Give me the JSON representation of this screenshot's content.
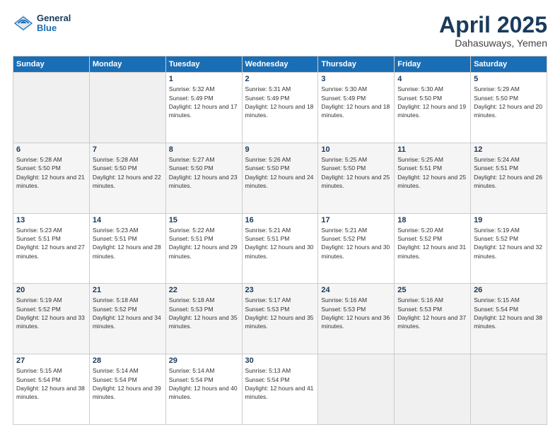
{
  "header": {
    "logo_general": "General",
    "logo_blue": "Blue",
    "month": "April 2025",
    "location": "Dahasuways, Yemen"
  },
  "days_of_week": [
    "Sunday",
    "Monday",
    "Tuesday",
    "Wednesday",
    "Thursday",
    "Friday",
    "Saturday"
  ],
  "weeks": [
    [
      {
        "day": "",
        "sunrise": "",
        "sunset": "",
        "daylight": ""
      },
      {
        "day": "",
        "sunrise": "",
        "sunset": "",
        "daylight": ""
      },
      {
        "day": "1",
        "sunrise": "Sunrise: 5:32 AM",
        "sunset": "Sunset: 5:49 PM",
        "daylight": "Daylight: 12 hours and 17 minutes."
      },
      {
        "day": "2",
        "sunrise": "Sunrise: 5:31 AM",
        "sunset": "Sunset: 5:49 PM",
        "daylight": "Daylight: 12 hours and 18 minutes."
      },
      {
        "day": "3",
        "sunrise": "Sunrise: 5:30 AM",
        "sunset": "Sunset: 5:49 PM",
        "daylight": "Daylight: 12 hours and 18 minutes."
      },
      {
        "day": "4",
        "sunrise": "Sunrise: 5:30 AM",
        "sunset": "Sunset: 5:50 PM",
        "daylight": "Daylight: 12 hours and 19 minutes."
      },
      {
        "day": "5",
        "sunrise": "Sunrise: 5:29 AM",
        "sunset": "Sunset: 5:50 PM",
        "daylight": "Daylight: 12 hours and 20 minutes."
      }
    ],
    [
      {
        "day": "6",
        "sunrise": "Sunrise: 5:28 AM",
        "sunset": "Sunset: 5:50 PM",
        "daylight": "Daylight: 12 hours and 21 minutes."
      },
      {
        "day": "7",
        "sunrise": "Sunrise: 5:28 AM",
        "sunset": "Sunset: 5:50 PM",
        "daylight": "Daylight: 12 hours and 22 minutes."
      },
      {
        "day": "8",
        "sunrise": "Sunrise: 5:27 AM",
        "sunset": "Sunset: 5:50 PM",
        "daylight": "Daylight: 12 hours and 23 minutes."
      },
      {
        "day": "9",
        "sunrise": "Sunrise: 5:26 AM",
        "sunset": "Sunset: 5:50 PM",
        "daylight": "Daylight: 12 hours and 24 minutes."
      },
      {
        "day": "10",
        "sunrise": "Sunrise: 5:25 AM",
        "sunset": "Sunset: 5:50 PM",
        "daylight": "Daylight: 12 hours and 25 minutes."
      },
      {
        "day": "11",
        "sunrise": "Sunrise: 5:25 AM",
        "sunset": "Sunset: 5:51 PM",
        "daylight": "Daylight: 12 hours and 25 minutes."
      },
      {
        "day": "12",
        "sunrise": "Sunrise: 5:24 AM",
        "sunset": "Sunset: 5:51 PM",
        "daylight": "Daylight: 12 hours and 26 minutes."
      }
    ],
    [
      {
        "day": "13",
        "sunrise": "Sunrise: 5:23 AM",
        "sunset": "Sunset: 5:51 PM",
        "daylight": "Daylight: 12 hours and 27 minutes."
      },
      {
        "day": "14",
        "sunrise": "Sunrise: 5:23 AM",
        "sunset": "Sunset: 5:51 PM",
        "daylight": "Daylight: 12 hours and 28 minutes."
      },
      {
        "day": "15",
        "sunrise": "Sunrise: 5:22 AM",
        "sunset": "Sunset: 5:51 PM",
        "daylight": "Daylight: 12 hours and 29 minutes."
      },
      {
        "day": "16",
        "sunrise": "Sunrise: 5:21 AM",
        "sunset": "Sunset: 5:51 PM",
        "daylight": "Daylight: 12 hours and 30 minutes."
      },
      {
        "day": "17",
        "sunrise": "Sunrise: 5:21 AM",
        "sunset": "Sunset: 5:52 PM",
        "daylight": "Daylight: 12 hours and 30 minutes."
      },
      {
        "day": "18",
        "sunrise": "Sunrise: 5:20 AM",
        "sunset": "Sunset: 5:52 PM",
        "daylight": "Daylight: 12 hours and 31 minutes."
      },
      {
        "day": "19",
        "sunrise": "Sunrise: 5:19 AM",
        "sunset": "Sunset: 5:52 PM",
        "daylight": "Daylight: 12 hours and 32 minutes."
      }
    ],
    [
      {
        "day": "20",
        "sunrise": "Sunrise: 5:19 AM",
        "sunset": "Sunset: 5:52 PM",
        "daylight": "Daylight: 12 hours and 33 minutes."
      },
      {
        "day": "21",
        "sunrise": "Sunrise: 5:18 AM",
        "sunset": "Sunset: 5:52 PM",
        "daylight": "Daylight: 12 hours and 34 minutes."
      },
      {
        "day": "22",
        "sunrise": "Sunrise: 5:18 AM",
        "sunset": "Sunset: 5:53 PM",
        "daylight": "Daylight: 12 hours and 35 minutes."
      },
      {
        "day": "23",
        "sunrise": "Sunrise: 5:17 AM",
        "sunset": "Sunset: 5:53 PM",
        "daylight": "Daylight: 12 hours and 35 minutes."
      },
      {
        "day": "24",
        "sunrise": "Sunrise: 5:16 AM",
        "sunset": "Sunset: 5:53 PM",
        "daylight": "Daylight: 12 hours and 36 minutes."
      },
      {
        "day": "25",
        "sunrise": "Sunrise: 5:16 AM",
        "sunset": "Sunset: 5:53 PM",
        "daylight": "Daylight: 12 hours and 37 minutes."
      },
      {
        "day": "26",
        "sunrise": "Sunrise: 5:15 AM",
        "sunset": "Sunset: 5:54 PM",
        "daylight": "Daylight: 12 hours and 38 minutes."
      }
    ],
    [
      {
        "day": "27",
        "sunrise": "Sunrise: 5:15 AM",
        "sunset": "Sunset: 5:54 PM",
        "daylight": "Daylight: 12 hours and 38 minutes."
      },
      {
        "day": "28",
        "sunrise": "Sunrise: 5:14 AM",
        "sunset": "Sunset: 5:54 PM",
        "daylight": "Daylight: 12 hours and 39 minutes."
      },
      {
        "day": "29",
        "sunrise": "Sunrise: 5:14 AM",
        "sunset": "Sunset: 5:54 PM",
        "daylight": "Daylight: 12 hours and 40 minutes."
      },
      {
        "day": "30",
        "sunrise": "Sunrise: 5:13 AM",
        "sunset": "Sunset: 5:54 PM",
        "daylight": "Daylight: 12 hours and 41 minutes."
      },
      {
        "day": "",
        "sunrise": "",
        "sunset": "",
        "daylight": ""
      },
      {
        "day": "",
        "sunrise": "",
        "sunset": "",
        "daylight": ""
      },
      {
        "day": "",
        "sunrise": "",
        "sunset": "",
        "daylight": ""
      }
    ]
  ]
}
